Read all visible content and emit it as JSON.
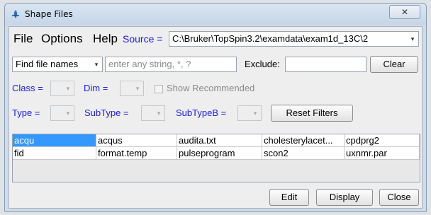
{
  "window": {
    "title": "Shape Files",
    "close_glyph": "✕"
  },
  "menubar": {
    "file": "File",
    "options": "Options",
    "help": "Help",
    "source_label": "Source =",
    "source_value": "C:\\Bruker\\TopSpin3.2\\examdata\\exam1d_13C\\2"
  },
  "search": {
    "mode": "Find file names",
    "query": "enter any string, *, ?",
    "exclude_label": "Exclude:",
    "exclude_value": "",
    "clear": "Clear"
  },
  "filters": {
    "class_label": "Class =",
    "dim_label": "Dim =",
    "show_recommended": "Show Recommended",
    "type_label": "Type =",
    "subtype_label": "SubType =",
    "subtypeb_label": "SubTypeB =",
    "reset": "Reset Filters"
  },
  "files": {
    "rows": [
      [
        "acqu",
        "acqus",
        "audita.txt",
        "cholesterylacet...",
        "cpdprg2"
      ],
      [
        "fid",
        "format.temp",
        "pulseprogram",
        "scon2",
        "uxnmr.par"
      ]
    ],
    "selected": "acqu"
  },
  "actions": {
    "edit": "Edit",
    "display": "Display",
    "close": "Close"
  },
  "icons": {
    "app": "topspin-shape-icon",
    "dropdown": "▾"
  }
}
